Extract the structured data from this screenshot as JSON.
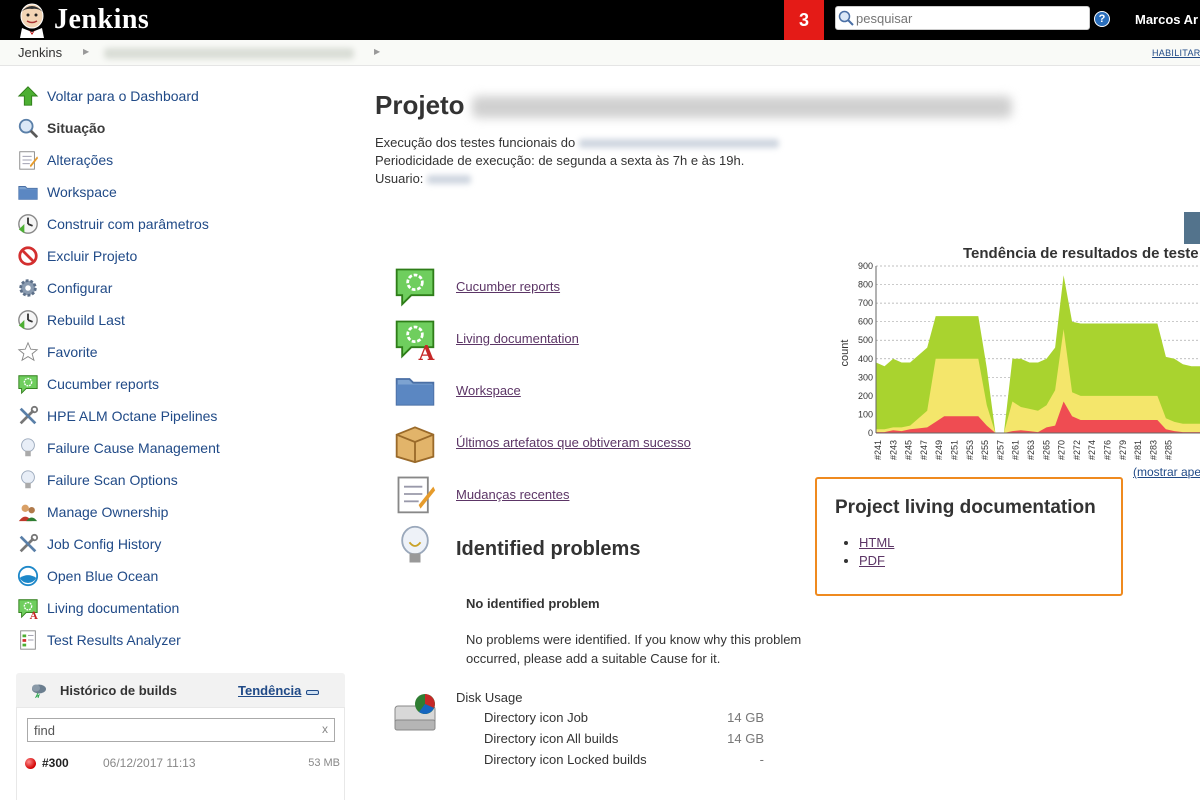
{
  "header": {
    "app_name": "Jenkins",
    "notification_count": "3",
    "search_placeholder": "pesquisar",
    "help_icon": "?",
    "user_name": "Marcos Ar"
  },
  "breadcrumb": {
    "root": "Jenkins",
    "enable_auto_refresh": "HABILITAR"
  },
  "sidebar": {
    "tasks": [
      {
        "label": "Voltar para o Dashboard",
        "icon": "up-arrow-icon"
      },
      {
        "label": "Situação",
        "icon": "magnifier-icon",
        "active": true
      },
      {
        "label": "Alterações",
        "icon": "notepad-icon"
      },
      {
        "label": "Workspace",
        "icon": "folder-icon"
      },
      {
        "label": "Construir com parâmetros",
        "icon": "clock-icon"
      },
      {
        "label": "Excluir Projeto",
        "icon": "no-entry-icon"
      },
      {
        "label": "Configurar",
        "icon": "gear-icon"
      },
      {
        "label": "Rebuild Last",
        "icon": "clock-icon"
      },
      {
        "label": "Favorite",
        "icon": "star-icon"
      },
      {
        "label": "Cucumber reports",
        "icon": "cucumber-icon"
      },
      {
        "label": "HPE ALM Octane Pipelines",
        "icon": "tools-icon"
      },
      {
        "label": "Failure Cause Management",
        "icon": "lightbulb-icon"
      },
      {
        "label": "Failure Scan Options",
        "icon": "lightbulb-icon"
      },
      {
        "label": "Manage Ownership",
        "icon": "people-icon"
      },
      {
        "label": "Job Config History",
        "icon": "tools-icon"
      },
      {
        "label": "Open Blue Ocean",
        "icon": "blue-ocean-icon"
      },
      {
        "label": "Living documentation",
        "icon": "cucumber-a-icon"
      },
      {
        "label": "Test Results Analyzer",
        "icon": "results-icon"
      }
    ]
  },
  "build_history": {
    "title": "Histórico de builds",
    "trend_link": "Tendência",
    "find_value": "find",
    "clear": "x",
    "builds": [
      {
        "number": "#300",
        "date": "06/12/2017 11:13",
        "size": "53 MB",
        "status": "failed"
      }
    ]
  },
  "main": {
    "title_prefix": "Projeto",
    "desc_line1": "Execução dos testes funcionais do",
    "desc_line2": "Periodicidade de execução: de segunda a sexta às 7h e às 19h.",
    "desc_line3": "Usuario:",
    "links": [
      {
        "label": "Cucumber reports",
        "icon": "cucumber-icon"
      },
      {
        "label": "Living documentation",
        "icon": "cucumber-a-icon"
      },
      {
        "label": "Workspace",
        "icon": "folder-icon"
      },
      {
        "label": "Últimos artefatos que obtiveram sucesso",
        "icon": "package-icon"
      },
      {
        "label": "Mudanças recentes",
        "icon": "notepad-icon"
      }
    ],
    "identified_problems": {
      "title": "Identified problems",
      "subtitle": "No identified problem",
      "text": "No problems were identified. If you know why this problem occurred, please add a suitable Cause for it."
    },
    "disk_usage": {
      "title": "Disk Usage",
      "rows": [
        {
          "label": "Directory icon Job",
          "value": "14 GB"
        },
        {
          "label": "Directory icon All builds",
          "value": "14 GB"
        },
        {
          "label": "Directory icon Locked builds",
          "value": "-"
        }
      ]
    }
  },
  "living_doc_box": {
    "title": "Project living documentation",
    "links": [
      "HTML",
      "PDF"
    ]
  },
  "colors": {
    "header_bg": "#000000",
    "notification_bg": "#e41b17",
    "link": "#204a87",
    "visited_link": "#5c3566",
    "highlight_border": "#ef8a1f",
    "passed": "#a9d32f",
    "skipped": "#f4e66b",
    "failed": "#ef4c52"
  },
  "chart_data": {
    "type": "area",
    "title": "Tendência de resultados de teste",
    "ylabel": "count",
    "ylim": [
      0,
      900
    ],
    "yticks": [
      0,
      100,
      200,
      300,
      400,
      500,
      600,
      700,
      800,
      900
    ],
    "xtick_labels": [
      "#241",
      "#243",
      "#245",
      "#247",
      "#249",
      "#251",
      "#253",
      "#255",
      "#257",
      "#261",
      "#263",
      "#265",
      "#270",
      "#272",
      "#274",
      "#276",
      "#279",
      "#281",
      "#283",
      "#285"
    ],
    "x": [
      "#241",
      "#242",
      "#243",
      "#244",
      "#245",
      "#246",
      "#247",
      "#248",
      "#249",
      "#250",
      "#251",
      "#252",
      "#253",
      "#254",
      "#255",
      "#256",
      "#257",
      "#259",
      "#261",
      "#262",
      "#263",
      "#264",
      "#265",
      "#266",
      "#270",
      "#271",
      "#272",
      "#273",
      "#274",
      "#275",
      "#276",
      "#277",
      "#279",
      "#280",
      "#281",
      "#282",
      "#283",
      "#284",
      "#285"
    ],
    "series": [
      {
        "name": "failed",
        "values": [
          5,
          5,
          15,
          10,
          20,
          25,
          30,
          60,
          90,
          90,
          90,
          90,
          90,
          40,
          0,
          0,
          10,
          15,
          10,
          5,
          30,
          40,
          170,
          90,
          70,
          70,
          70,
          70,
          70,
          70,
          70,
          70,
          70,
          70,
          20,
          10,
          5,
          5,
          5
        ]
      },
      {
        "name": "skipped",
        "values": [
          20,
          20,
          30,
          30,
          40,
          80,
          120,
          400,
          400,
          400,
          400,
          400,
          400,
          150,
          0,
          0,
          170,
          140,
          130,
          120,
          150,
          230,
          560,
          220,
          200,
          200,
          200,
          200,
          200,
          200,
          200,
          200,
          200,
          200,
          80,
          60,
          50,
          50,
          50
        ]
      },
      {
        "name": "passed",
        "values": [
          380,
          360,
          400,
          380,
          380,
          420,
          460,
          630,
          630,
          630,
          630,
          630,
          630,
          350,
          0,
          0,
          400,
          400,
          380,
          380,
          400,
          460,
          850,
          600,
          590,
          590,
          590,
          590,
          590,
          590,
          590,
          590,
          590,
          590,
          410,
          400,
          370,
          360,
          360
        ]
      }
    ],
    "annotation": "(mostrar apenas falhas)",
    "grid": true
  }
}
